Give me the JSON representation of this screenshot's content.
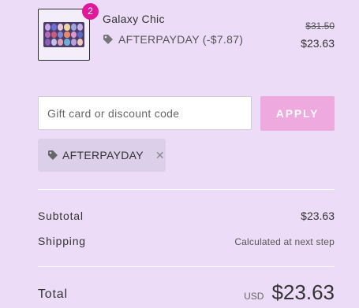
{
  "line_item": {
    "name": "Galaxy Chic",
    "quantity": "2",
    "discount_label": "AFTERPAYDAY (-$7.87)",
    "original_price": "$31.50",
    "price": "$23.63",
    "tag_icon": "tag-icon"
  },
  "discount": {
    "placeholder": "Gift card or discount code",
    "value": "",
    "apply_label": "APPLY",
    "applied_code": "AFTERPAYDAY",
    "remove_icon": "close-icon",
    "apply_color": "#eea9df"
  },
  "summary": {
    "subtotal_label": "Subtotal",
    "subtotal_value": "$23.63",
    "shipping_label": "Shipping",
    "shipping_value": "Calculated at next step",
    "total_label": "Total",
    "currency": "USD",
    "total_value": "$23.63"
  },
  "colors": {
    "background": "#ecdcf7",
    "badge": "#e0189a",
    "chip": "#dccfe9"
  }
}
